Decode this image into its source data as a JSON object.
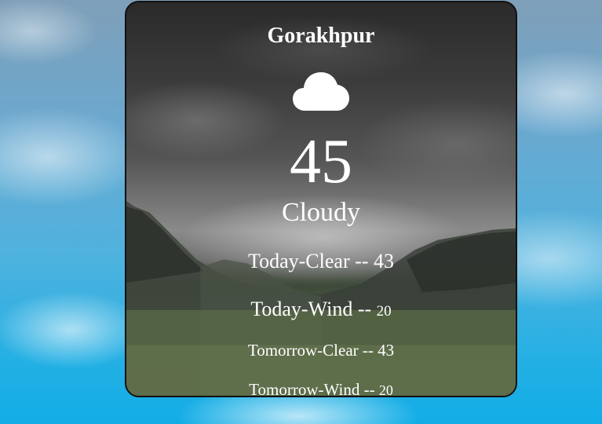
{
  "weather": {
    "city": "Gorakhpur",
    "icon": "cloud-icon",
    "temperature": "45",
    "condition": "Cloudy",
    "today_clear": {
      "label": "Today-Clear",
      "sep": "--",
      "value": "43"
    },
    "today_wind": {
      "label": "Today-Wind",
      "sep": "--",
      "value": "20"
    },
    "tomorrow_clear": {
      "label": "Tomorrow-Clear",
      "sep": "--",
      "value": "43"
    },
    "tomorrow_wind": {
      "label": "Tomorrow-Wind",
      "sep": "--",
      "value": "20"
    }
  },
  "colors": {
    "text": "#ffffff",
    "card_border": "#111111",
    "sky": "#12ade6"
  }
}
